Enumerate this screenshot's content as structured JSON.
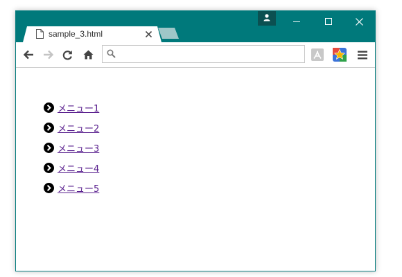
{
  "colors": {
    "titlebar": "#00797b",
    "profile_button": "#0b5051",
    "new_tab": "#9ec7c8",
    "link_visited": "#551a8b",
    "extension_blue": "#3b73d9",
    "extension_star": "#f6b400"
  },
  "tab": {
    "title": "sample_3.html",
    "icon": "page-icon",
    "close_icon": "close-icon"
  },
  "window_controls": {
    "profile_icon": "person-icon",
    "minimize_icon": "minimize-icon",
    "maximize_icon": "maximize-icon",
    "close_icon": "close-icon"
  },
  "toolbar": {
    "back_icon": "arrow-left-icon",
    "forward_icon": "arrow-right-icon",
    "reload_icon": "reload-icon",
    "home_icon": "home-icon",
    "omnibox_icon": "search-icon",
    "address": "",
    "pdf_icon": "pdf-icon",
    "extension_icon": "star-extension-icon",
    "menu_icon": "hamburger-icon"
  },
  "page": {
    "bullet_icon": "chevron-circle-right-icon",
    "menu_items": [
      {
        "label": "メニュー1"
      },
      {
        "label": "メニュー2"
      },
      {
        "label": "メニュー3"
      },
      {
        "label": "メニュー4"
      },
      {
        "label": "メニュー5"
      }
    ]
  }
}
